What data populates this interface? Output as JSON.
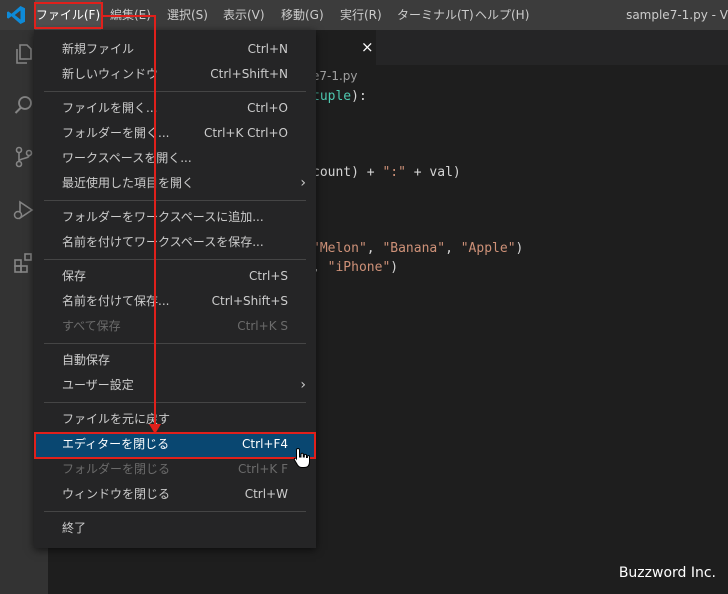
{
  "menubar": {
    "items": [
      "ファイル(F)",
      "編集(E)",
      "選択(S)",
      "表示(V)",
      "移動(G)",
      "実行(R)",
      "ターミナル(T)",
      "ヘルプ(H)"
    ]
  },
  "window_title": "sample7-1.py - V",
  "editor": {
    "tab_close": "×",
    "breadcrumb": "e7-1.py",
    "lines": {
      "l1_type": "tuple",
      "l1_rest": "):",
      "l2_pre": "count) + ",
      "l2_str": "\":\"",
      "l2_post": " + val)",
      "l3_s1": "\"Melon\"",
      "l3_s2": "\"Banana\"",
      "l3_s3": "\"Apple\"",
      "l3_end": ")",
      "l4_pre": ", ",
      "l4_str": "\"iPhone\"",
      "l4_end": ")",
      "comma": ", "
    }
  },
  "file_menu": {
    "items": [
      {
        "label": "新規ファイル",
        "shortcut": "Ctrl+N"
      },
      {
        "label": "新しいウィンドウ",
        "shortcut": "Ctrl+Shift+N"
      },
      {
        "label": "ファイルを開く...",
        "shortcut": "Ctrl+O"
      },
      {
        "label": "フォルダーを開く...",
        "shortcut": "Ctrl+K Ctrl+O"
      },
      {
        "label": "ワークスペースを開く...",
        "shortcut": ""
      },
      {
        "label": "最近使用した項目を開く",
        "shortcut": "",
        "submenu": "›"
      },
      {
        "label": "フォルダーをワークスペースに追加...",
        "shortcut": ""
      },
      {
        "label": "名前を付けてワークスペースを保存...",
        "shortcut": ""
      },
      {
        "label": "保存",
        "shortcut": "Ctrl+S"
      },
      {
        "label": "名前を付けて保存...",
        "shortcut": "Ctrl+Shift+S"
      },
      {
        "label": "すべて保存",
        "shortcut": "Ctrl+K S",
        "disabled": true
      },
      {
        "label": "自動保存",
        "shortcut": ""
      },
      {
        "label": "ユーザー設定",
        "shortcut": "",
        "submenu": "›"
      },
      {
        "label": "ファイルを元に戻す",
        "shortcut": ""
      },
      {
        "label": "エディターを閉じる",
        "shortcut": "Ctrl+F4",
        "highlighted": true
      },
      {
        "label": "フォルダーを閉じる",
        "shortcut": "Ctrl+K F",
        "disabled": true
      },
      {
        "label": "ウィンドウを閉じる",
        "shortcut": "Ctrl+W"
      },
      {
        "label": "終了",
        "shortcut": ""
      }
    ]
  },
  "colors": {
    "accent_highlight": "#094771",
    "annotation_red": "#e0201b",
    "vscode_blue": "#0065a9"
  },
  "icons": [
    "vscode-logo-icon",
    "explorer-icon",
    "search-icon",
    "source-control-icon",
    "run-debug-icon",
    "extensions-icon",
    "hand-cursor-icon"
  ],
  "watermark": "Buzzword Inc."
}
